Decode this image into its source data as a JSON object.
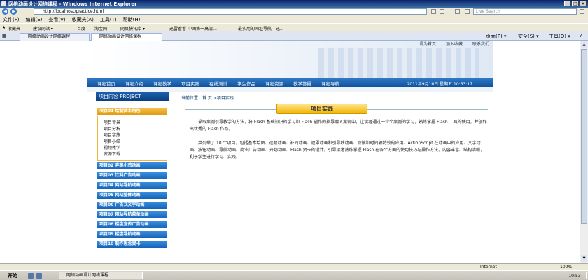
{
  "window": {
    "title": "网络动画设计网络课程 - Windows Internet Explorer",
    "buttons": [
      "_",
      "□",
      "×"
    ]
  },
  "address": {
    "url": "http://localhost/practice.html",
    "search_placeholder": "Live Search"
  },
  "menu": [
    "文件(F)",
    "编辑(E)",
    "查看(V)",
    "收藏夹(A)",
    "工具(T)",
    "帮助(H)"
  ],
  "favorites": {
    "label": "收藏夹",
    "items": [
      "建议网站 ▾",
      "百度",
      "淘宝网",
      "网页快讯库 ▾",
      "迅雷看看-中国第一高清...",
      "最实用的网址导航 - 迅..."
    ]
  },
  "tabs": [
    {
      "label": "网络动画设计网络课程"
    },
    {
      "label": "网络动画设计网络课程"
    }
  ],
  "ie_tools": [
    "页面(P) ▾",
    "安全(S) ▾",
    "工具(O) ▾",
    "?"
  ],
  "site": {
    "top_links": [
      "设为首页",
      "加入收藏",
      "联系我们"
    ],
    "nav": [
      "课程首页",
      "课程介绍",
      "课程教学",
      "项目实践",
      "在线测试",
      "学生作品",
      "课程资源",
      "教学答疑",
      "课程导航"
    ],
    "date": "2011年9月16日 星期五 10:53:17",
    "sidebar_title": "项目内容 PROJECT",
    "active_project": "项目01 绘制武士角色",
    "sub_items": [
      "项目背景",
      "项目分析",
      "项目实施",
      "项目小结",
      "视频教学",
      "资源下载"
    ],
    "projects": [
      "项目02 奔跑小鸡动画",
      "项目03 饮料广告动画",
      "项目04 网站导航动画",
      "项目05 网站整体动画",
      "项目06 广告式文字动画",
      "项目07 网站导航菜单动画",
      "项目08 楼盘宣传广告动画",
      "项目09 楼盘导航动画",
      "项目10 制作思念贺卡"
    ],
    "breadcrumb": "当前位置：首 页 >项目实践",
    "section_title": "项目实践",
    "paragraph1": "采取案例引导教学的方法，将 Flash 基础知识的学习和 Flash 创作的指导融入案例中，让读者通过一个个案例的学习，熟练掌握 Flash 工具的使用，并创作出优秀的 Flash 作品。",
    "paragraph2": "共列举了 10 个项目，包括基本绘图、逐帧动画、补间动画、遮罩动画和引导线动画、滤镜和时间轴特效的应用、ActionScript 在动画中的应用、文字动画、按钮动画、导航动画、商业广告动画、开场动画、Flash 贺卡的设计。引导读者熟练掌握 Flash 在各个方面的使用技巧与操作方法。内容丰富、结构清晰，利于学生进行学习、实践。"
  },
  "status": {
    "zone": "Internet",
    "zoom": "100%"
  },
  "taskbar": {
    "start": "开始",
    "task": "网络动画设计网络课程 ...",
    "clock": "10:53"
  }
}
